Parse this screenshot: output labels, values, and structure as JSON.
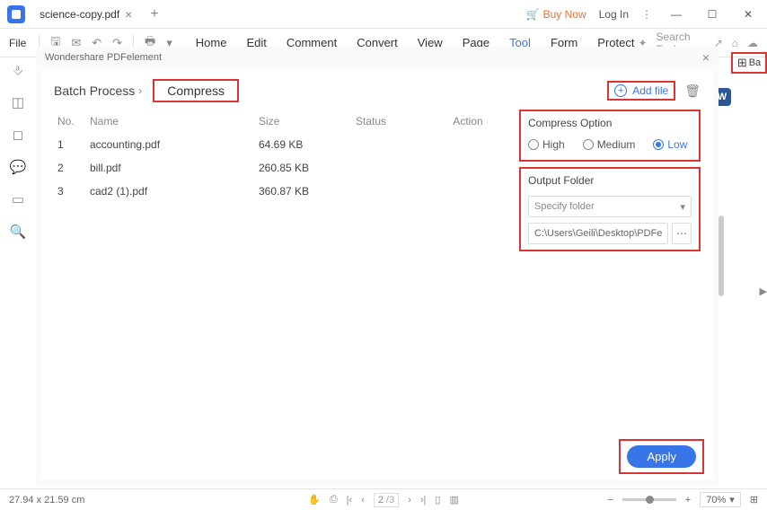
{
  "titlebar": {
    "tab_name": "science-copy.pdf",
    "buy_now": "Buy Now",
    "login": "Log In"
  },
  "toolbar": {
    "file": "File",
    "menu": [
      "Home",
      "Edit",
      "Comment",
      "Convert",
      "View",
      "Page",
      "Tool",
      "Form",
      "Protect"
    ],
    "active": "Tool",
    "search_placeholder": "Search Tools"
  },
  "dialog": {
    "title": "Wondershare PDFelement",
    "batch_label": "Batch Process",
    "tab_label": "Compress",
    "add_file": "Add file",
    "columns": {
      "no": "No.",
      "name": "Name",
      "size": "Size",
      "status": "Status",
      "action": "Action"
    },
    "rows": [
      {
        "no": "1",
        "name": "accounting.pdf",
        "size": "64.69 KB"
      },
      {
        "no": "2",
        "name": "bill.pdf",
        "size": "260.85 KB"
      },
      {
        "no": "3",
        "name": "cad2 (1).pdf",
        "size": "360.87 KB"
      }
    ],
    "compress_title": "Compress Option",
    "radio_high": "High",
    "radio_medium": "Medium",
    "radio_low": "Low",
    "output_title": "Output Folder",
    "output_placeholder": "Specify folder",
    "output_path": "C:\\Users\\Geili\\Desktop\\PDFelement\\O",
    "apply": "Apply"
  },
  "right": {
    "batch": "Ba"
  },
  "statusbar": {
    "dims": "27.94 x 21.59 cm",
    "page": "2",
    "total": "/3",
    "zoom": "70%"
  }
}
